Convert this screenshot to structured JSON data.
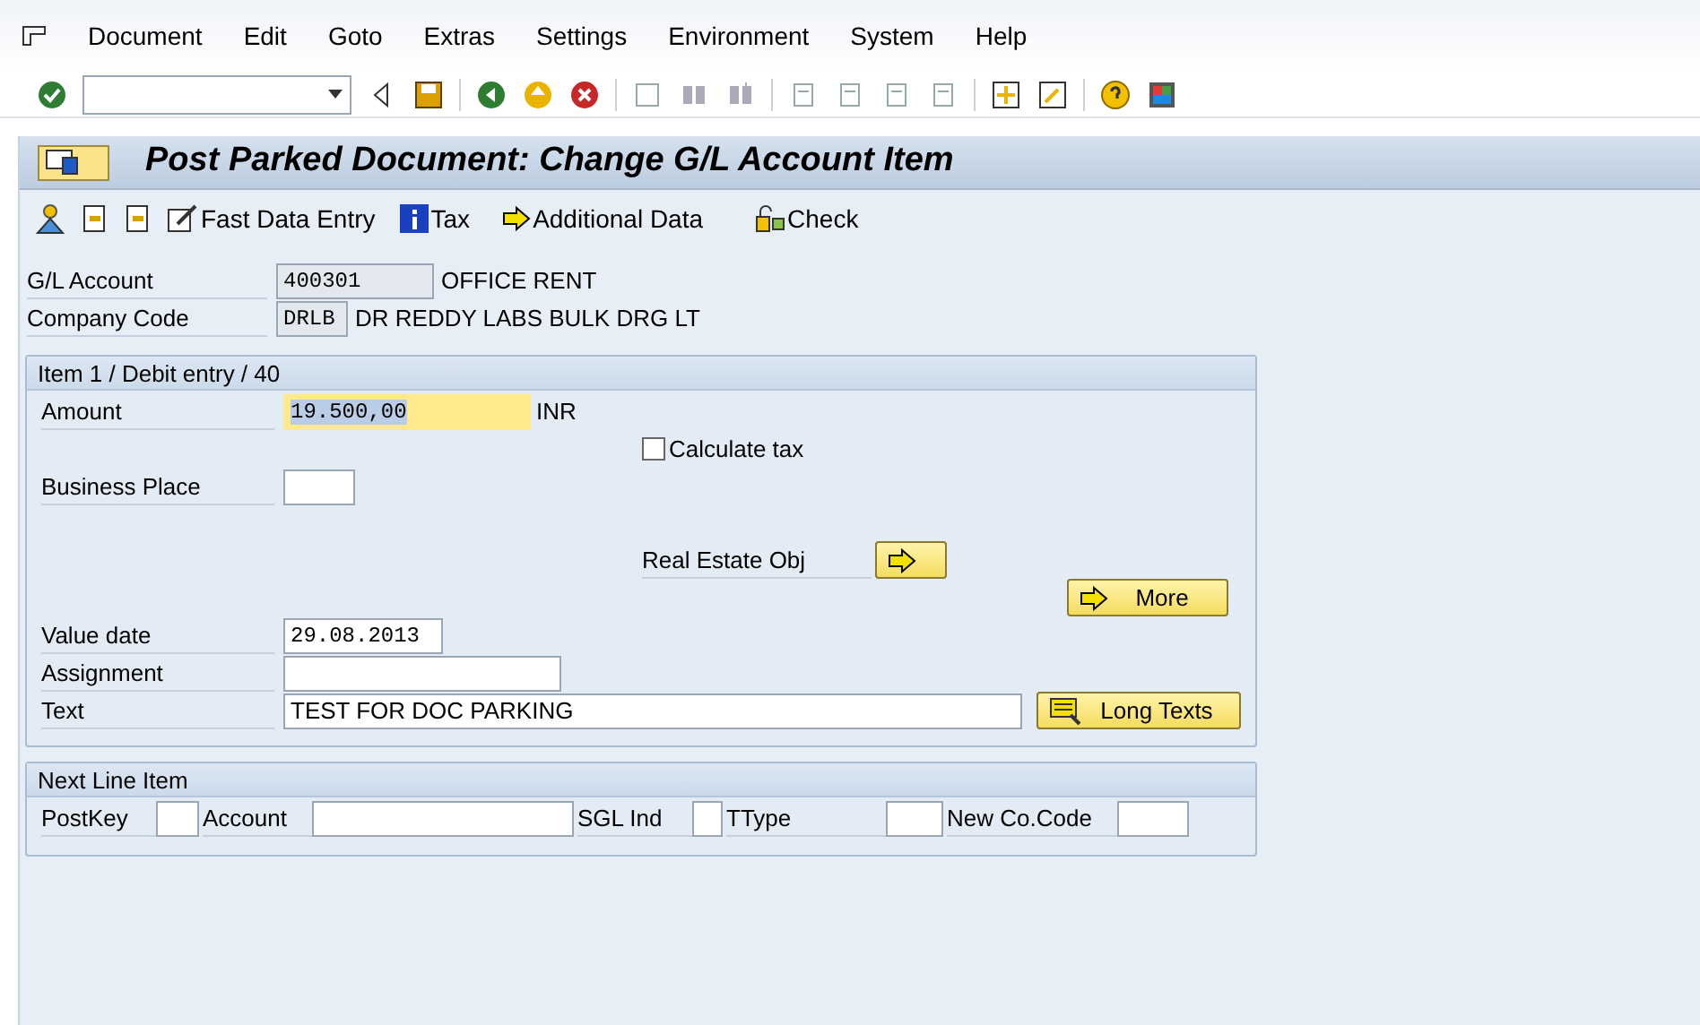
{
  "menu": [
    "Document",
    "Edit",
    "Goto",
    "Extras",
    "Settings",
    "Environment",
    "System",
    "Help"
  ],
  "title": "Post Parked Document: Change G/L Account Item",
  "app_toolbar": [
    {
      "kind": "person"
    },
    {
      "kind": "prev"
    },
    {
      "kind": "next"
    },
    {
      "kind": "fast",
      "label": "Fast Data Entry"
    },
    {
      "kind": "info",
      "label": "Tax"
    },
    {
      "kind": "arrow",
      "label": "Additional Data"
    },
    {
      "kind": "check",
      "label": "Check"
    }
  ],
  "header": [
    {
      "label": "G/L Account",
      "value": "400301",
      "text": "OFFICE RENT"
    },
    {
      "label": "Company Code",
      "value": "DRLB",
      "text": "DR REDDY LABS BULK DRG LT"
    }
  ],
  "item": {
    "title": "Item 1 / Debit entry / 40",
    "amount": {
      "label": "Amount",
      "value": "19.500,00",
      "currency": "INR",
      "focused": true
    },
    "calculate_tax": {
      "label": "Calculate tax",
      "checked": false
    },
    "business_place": {
      "label": "Business Place"
    },
    "real_estate": {
      "label": "Real Estate Obj"
    },
    "more_button": "More",
    "value_date": {
      "label": "Value date",
      "value": "29.08.2013"
    },
    "assignment": {
      "label": "Assignment"
    },
    "text": {
      "label": "Text",
      "value": "TEST FOR DOC PARKING"
    },
    "long_texts_button": "Long Texts"
  },
  "next_line": {
    "title": "Next Line Item",
    "fields": [
      {
        "label": "PostKey"
      },
      {
        "label": "Account"
      },
      {
        "label": "SGL Ind"
      },
      {
        "label": "TType"
      },
      {
        "label": "New Co.Code"
      }
    ]
  }
}
